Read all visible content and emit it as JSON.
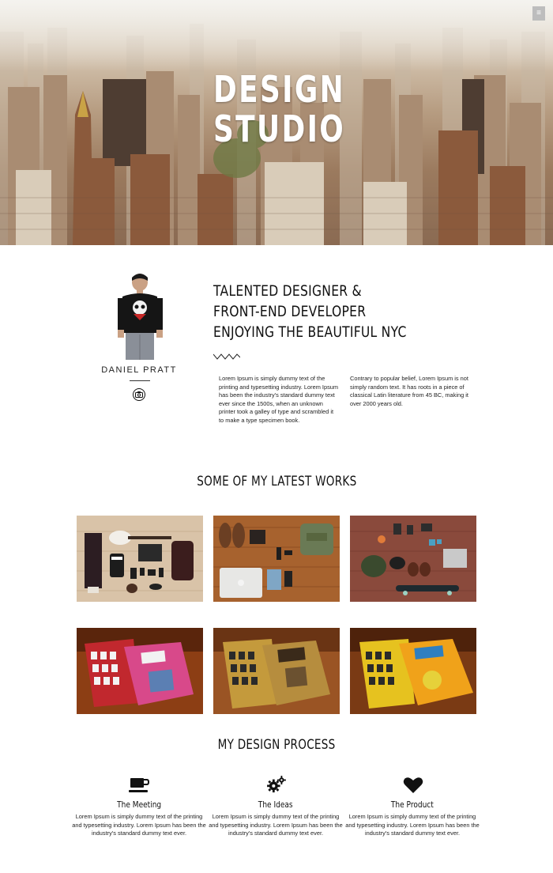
{
  "hero": {
    "title_line1": "DESIGN",
    "title_line2": "STUDIO",
    "menu_icon": "hamburger-icon",
    "menu_glyph": "≡"
  },
  "profile": {
    "name": "DANIEL PRATT",
    "social_icon": "camera-icon",
    "headline": [
      "TALENTED DESIGNER &",
      "FRONT-END DEVELOPER",
      "ENJOYING THE BEAUTIFUL NYC"
    ],
    "paragraph1": "Lorem Ipsum is simply dummy text of the printing and typesetting industry. Lorem Ipsum has been the industry's standard dummy text ever since the 1500s, when an unknown printer took a galley of type and scrambled it to make a type specimen book.",
    "paragraph2": "Contrary to popular belief, Lorem Ipsum is not simply random text. It has roots in a piece of classical Latin literature from 45 BC, making it over 2000 years old."
  },
  "works": {
    "title": "SOME OF MY LATEST WORKS",
    "items": [
      {
        "name": "flat-lay-guitar"
      },
      {
        "name": "flat-lay-laptop"
      },
      {
        "name": "flat-lay-skateboard"
      },
      {
        "name": "book-mockup-red",
        "cover": "#c1282e",
        "accent": "#d8498a"
      },
      {
        "name": "book-mockup-olive",
        "cover": "#c49a3c",
        "accent": "#8a6d2a"
      },
      {
        "name": "book-mockup-yellow",
        "cover": "#e6c21f",
        "accent": "#f0a21a"
      }
    ]
  },
  "process": {
    "title": "MY DESIGN PROCESS",
    "steps": [
      {
        "icon": "coffee-cup-icon",
        "name": "The Meeting",
        "text": "Lorem Ipsum is simply dummy text of the printing and typesetting industry. Lorem Ipsum has been the industry's standard dummy text ever."
      },
      {
        "icon": "gears-icon",
        "name": "The Ideas",
        "text": "Lorem Ipsum is simply dummy text of the printing and typesetting industry. Lorem Ipsum has been the industry's standard dummy text ever."
      },
      {
        "icon": "heart-icon",
        "name": "The Product",
        "text": "Lorem Ipsum is simply dummy text of the printing and typesetting industry. Lorem Ipsum has been the industry's standard dummy text ever."
      }
    ]
  },
  "colors": {
    "text": "#111111",
    "background": "#ffffff"
  }
}
